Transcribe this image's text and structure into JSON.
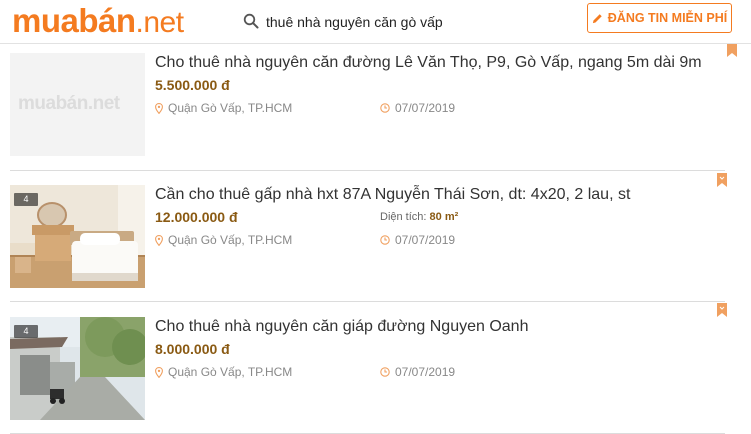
{
  "header": {
    "logo_main": "muabán",
    "logo_suffix": ".net",
    "search_value": "thuê nhà nguyên căn gò vấp",
    "post_button_label": "ĐĂNG TIN MIỄN PHÍ"
  },
  "listings": [
    {
      "title": "Cho thuê nhà nguyên căn đường Lê Văn Thọ, P9, Gò Vấp, ngang 5m dài 9m",
      "price": "5.500.000 đ",
      "location": "Quận Gò Vấp, TP.HCM",
      "date": "07/07/2019",
      "placeholder_logo": "muabán.net"
    },
    {
      "title": "Cần cho thuê gấp nhà hxt 87A Nguyễn Thái Sơn, dt: 4x20, 2 lau, st",
      "price": "12.000.000 đ",
      "area_label": "Diện tích:",
      "area_value": "80 m²",
      "location": "Quận Gò Vấp, TP.HCM",
      "date": "07/07/2019",
      "photo_count": "4"
    },
    {
      "title": "Cho thuê nhà nguyên căn giáp đường Nguyen Oanh",
      "price": "8.000.000 đ",
      "location": "Quận Gò Vấp, TP.HCM",
      "date": "07/07/2019",
      "photo_count": "4"
    }
  ],
  "colors": {
    "brand": "#f47b20",
    "price": "#8a5a13",
    "meta": "#888888"
  }
}
